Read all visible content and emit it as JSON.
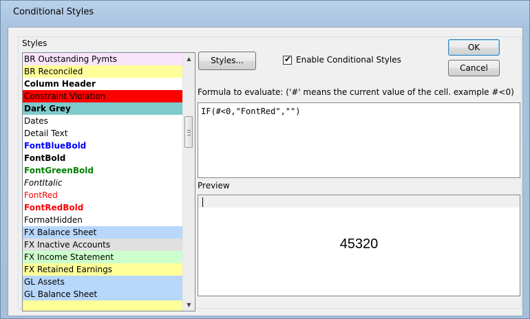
{
  "window": {
    "title": "Conditional Styles"
  },
  "styles_label": "Styles",
  "styles_list": [
    {
      "label": "BR Outstanding Pymts",
      "bg": "#f9e5f9",
      "color": "#000000",
      "bold": false,
      "italic": false
    },
    {
      "label": "BR Reconciled",
      "bg": "#ffff99",
      "color": "#000000",
      "bold": false,
      "italic": false
    },
    {
      "label": "Column Header",
      "bg": "#ffffff",
      "color": "#000000",
      "bold": true,
      "italic": false
    },
    {
      "label": "Constraint Violation",
      "bg": "#ff0000",
      "color": "#000000",
      "bold": false,
      "italic": false
    },
    {
      "label": "Dark Grey",
      "bg": "#7fcacb",
      "color": "#000000",
      "bold": true,
      "italic": false
    },
    {
      "label": "Dates",
      "bg": "#ffffff",
      "color": "#000000",
      "bold": false,
      "italic": false
    },
    {
      "label": "Detail Text",
      "bg": "#ffffff",
      "color": "#000000",
      "bold": false,
      "italic": false
    },
    {
      "label": "FontBlueBold",
      "bg": "#ffffff",
      "color": "#0000ff",
      "bold": true,
      "italic": false
    },
    {
      "label": "FontBold",
      "bg": "#ffffff",
      "color": "#000000",
      "bold": true,
      "italic": false
    },
    {
      "label": "FontGreenBold",
      "bg": "#ffffff",
      "color": "#008000",
      "bold": true,
      "italic": false
    },
    {
      "label": "FontItalic",
      "bg": "#ffffff",
      "color": "#000000",
      "bold": false,
      "italic": true
    },
    {
      "label": "FontRed",
      "bg": "#ffffff",
      "color": "#ff0000",
      "bold": false,
      "italic": false
    },
    {
      "label": "FontRedBold",
      "bg": "#ffffff",
      "color": "#ff0000",
      "bold": true,
      "italic": false
    },
    {
      "label": "FormatHidden",
      "bg": "#ffffff",
      "color": "#000000",
      "bold": false,
      "italic": false
    },
    {
      "label": "FX Balance Sheet",
      "bg": "#b7d7fb",
      "color": "#000000",
      "bold": false,
      "italic": false
    },
    {
      "label": "FX Inactive Accounts",
      "bg": "#e0e0e0",
      "color": "#000000",
      "bold": false,
      "italic": false
    },
    {
      "label": "FX Income Statement",
      "bg": "#ccffcc",
      "color": "#000000",
      "bold": false,
      "italic": false
    },
    {
      "label": "FX Retained Earnings",
      "bg": "#ffff99",
      "color": "#000000",
      "bold": false,
      "italic": false
    },
    {
      "label": "GL Assets",
      "bg": "#b7d7fb",
      "color": "#000000",
      "bold": false,
      "italic": false
    },
    {
      "label": "GL Balance Sheet",
      "bg": "#b7d7fb",
      "color": "#000000",
      "bold": false,
      "italic": false
    },
    {
      "label": "",
      "bg": "#ffff99",
      "color": "#000000",
      "bold": false,
      "italic": false
    }
  ],
  "buttons": {
    "styles": "Styles...",
    "ok": "OK",
    "cancel": "Cancel"
  },
  "enable_conditional": {
    "label": "Enable Conditional Styles",
    "checked": true,
    "mark": "✔"
  },
  "formula": {
    "label": "Formula to evaluate: ('#' means the current value of the cell. example #<0)",
    "value": "IF(#<0,\"FontRed\",\"\")"
  },
  "preview": {
    "label": "Preview",
    "value": "45320"
  },
  "scrollbar": {
    "up": "▲",
    "down": "▼"
  }
}
